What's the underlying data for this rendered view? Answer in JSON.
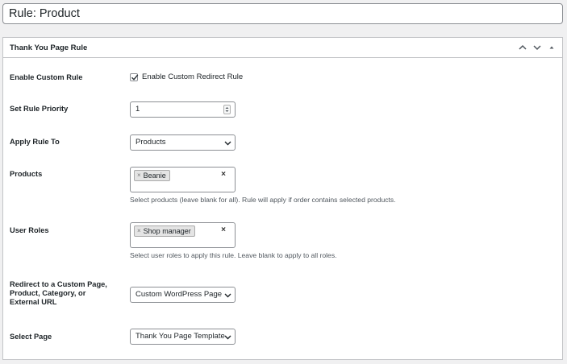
{
  "title": "Rule: Product",
  "postbox": {
    "title": "Thank You Page Rule"
  },
  "fields": {
    "enable_custom_rule": {
      "label": "Enable Custom Rule",
      "checkbox_label": "Enable Custom Redirect Rule",
      "checked": true
    },
    "rule_priority": {
      "label": "Set Rule Priority",
      "value": "1"
    },
    "apply_rule_to": {
      "label": "Apply Rule To",
      "selected": "Products"
    },
    "products": {
      "label": "Products",
      "tags": [
        "Beanie"
      ],
      "clear": "×",
      "description": "Select products (leave blank for all). Rule will apply if order contains selected products."
    },
    "user_roles": {
      "label": "User Roles",
      "tags": [
        "Shop manager"
      ],
      "clear": "×",
      "description": "Select user roles to apply this rule. Leave blank to apply to all roles."
    },
    "redirect": {
      "label": "Redirect to a Custom Page, Product, Category, or External URL",
      "selected": "Custom WordPress Page"
    },
    "select_page": {
      "label": "Select Page",
      "selected": "Thank You Page Template"
    }
  },
  "icons": {
    "move_up": "chevron-up-icon",
    "move_down": "chevron-down-icon",
    "toggle": "triangle-up-icon"
  },
  "colors": {
    "border": "#c3c4c7",
    "input_border": "#8c8f94",
    "text": "#1d2327",
    "description": "#50575e",
    "background": "#f0f0f1"
  }
}
